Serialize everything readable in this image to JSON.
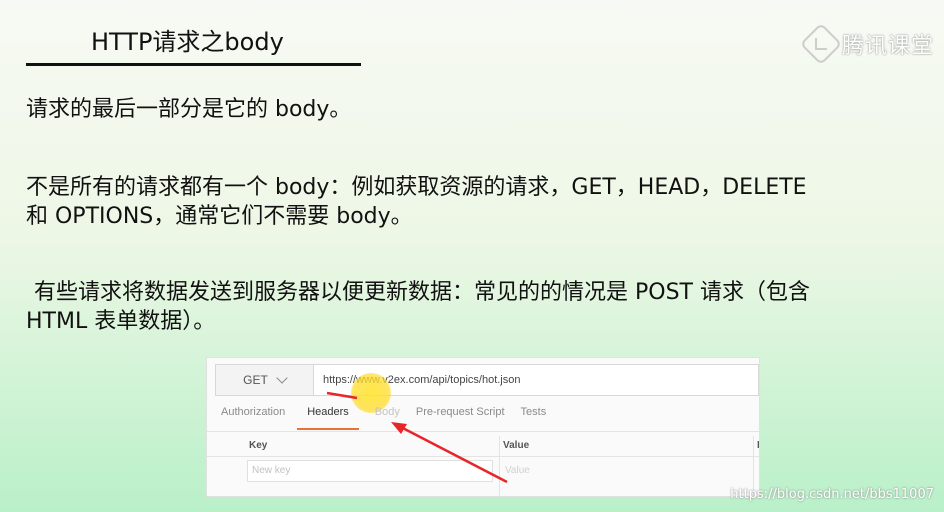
{
  "slide": {
    "title": "HTTP请求之body",
    "para1": "请求的最后一部分是它的 body。",
    "para2_line1": "不是所有的请求都有一个 body：例如获取资源的请求，GET，HEAD，DELETE",
    "para2_line2": "和 OPTIONS，通常它们不需要 body。",
    "para3_line1": "有些请求将数据发送到服务器以便更新数据：常见的的情况是 POST 请求（包含",
    "para3_line2": "HTML 表单数据）。"
  },
  "logo": {
    "text": "腾讯课堂",
    "icon": "play-logo-icon"
  },
  "screenshot": {
    "method": "GET",
    "url": "https://www.v2ex.com/api/topics/hot.json",
    "tabs": [
      "Authorization",
      "Headers",
      "Body",
      "Pre-request Script",
      "Tests"
    ],
    "active_tab": "Headers",
    "columns": {
      "key": "Key",
      "value": "Value",
      "desc": "D"
    },
    "new_key_placeholder": "New key",
    "new_value_placeholder": "Value",
    "annotation_color": "#e8262a",
    "highlight_color": "#ffe03c",
    "accent_color": "#e8703a"
  },
  "watermark": "https://blog.csdn.net/bbs11007"
}
